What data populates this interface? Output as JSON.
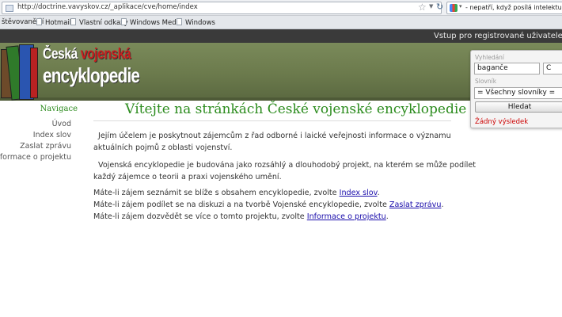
{
  "browser": {
    "url": "http://doctrine.vavyskov.cz/_aplikace/cve/home/index",
    "search_box_text": "- nepatří, když posílá intelektuály do ha",
    "bookmarks": [
      "štěvovanější",
      "Hotmail",
      "Vlastní odkazy",
      "Windows Media",
      "Windows"
    ]
  },
  "site": {
    "login_link": "Vstup pro registrované uživatele | Př",
    "logo_line1_a": "Česká",
    "logo_line1_b": "vojenská",
    "logo_line2": "encyklopedie",
    "colors": {
      "title_green": "#2c8c1e",
      "banner": "#6b7a4c",
      "topbar": "#3a3a3a",
      "logo_red": "#c81e1e"
    }
  },
  "search": {
    "label_search": "Vyhledání",
    "query_value": "baganče",
    "second_field_value": "C",
    "label_dictionary": "Slovník",
    "dictionary_selected": "= Všechny slovníky =",
    "button_label": "Hledat",
    "result_text": "Žádný výsledek"
  },
  "nav": {
    "title": "Navigace",
    "items": [
      "Úvod",
      "Index slov",
      "Zaslat zprávu",
      "Informace o projektu"
    ]
  },
  "main": {
    "title": "Vítejte na stránkách České vojenské encyklopedie",
    "p1_line1": "Jejím účelem je poskytnout zájemcům z řad odborné i laické veřejnosti informace o významu",
    "p1_line2": "aktuálních pojmů z oblasti vojenství.",
    "p2_line1": "Vojenská encyklopedie je budována jako rozsáhlý a dlouhodobý projekt, na kterém se může podílet",
    "p2_line2": "každý zájemce o teorii a praxi vojenského umění.",
    "l1_text": "Máte-li zájem seznámit se blíže s obsahem encyklopedie, zvolte ",
    "l1_link": "Index slov",
    "l2_text": "Máte-li zájem podílet se na diskuzi a na tvorbě Vojenské encyklopedie, zvolte ",
    "l2_link": "Zaslat zprávu",
    "l3_text": "Máte-li zájem dozvědět se více o tomto projektu, zvolte ",
    "l3_link": "Informace o projektu",
    "period": "."
  }
}
